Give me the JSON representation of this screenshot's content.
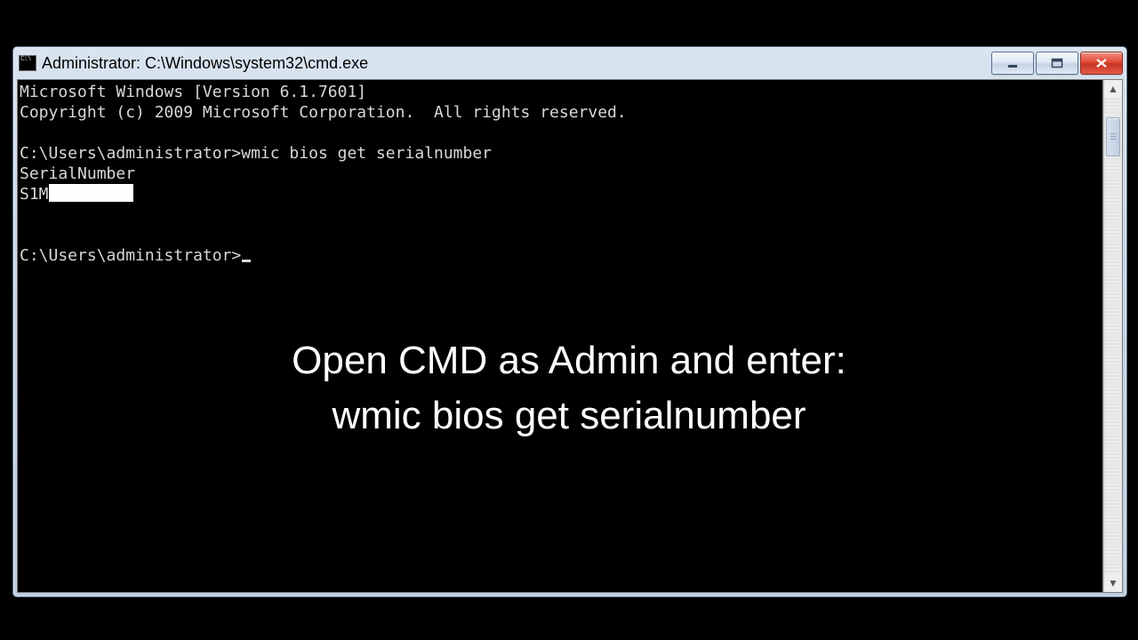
{
  "window": {
    "title": "Administrator: C:\\Windows\\system32\\cmd.exe"
  },
  "console": {
    "header1": "Microsoft Windows [Version 6.1.7601]",
    "header2": "Copyright (c) 2009 Microsoft Corporation.  All rights reserved.",
    "prompt1": "C:\\Users\\administrator>",
    "command1": "wmic bios get serialnumber",
    "output_header": "SerialNumber",
    "output_value_visible": "S1M",
    "prompt2": "C:\\Users\\administrator>"
  },
  "overlay": {
    "line1": "Open CMD as Admin and enter:",
    "line2": "wmic bios get serialnumber"
  }
}
